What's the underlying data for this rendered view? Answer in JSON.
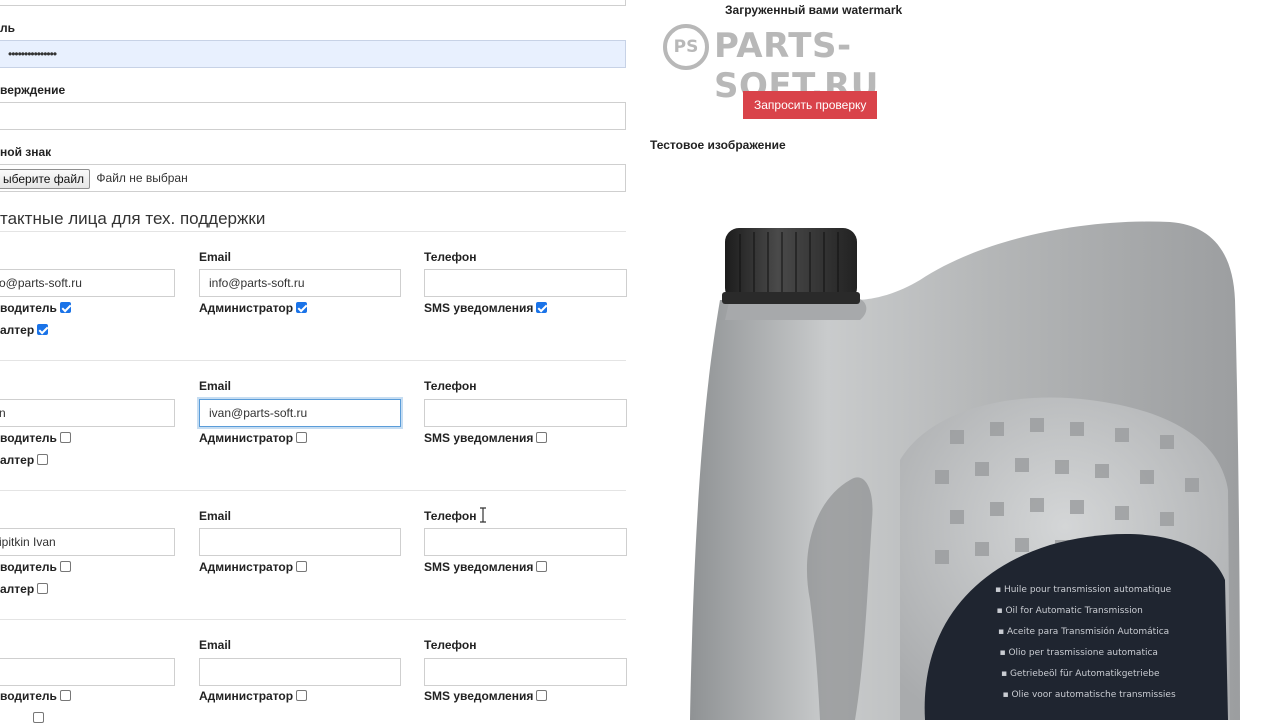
{
  "form": {
    "password_label": "ль",
    "password_value": "•••••••••••••••",
    "confirm_label": "верждение",
    "confirm_value": "",
    "watermark_label": "ной знак",
    "file_button": "ыберите файл",
    "file_status": "Файл не выбран",
    "contacts_title": "тактные лица для тех. поддержки"
  },
  "contacts": [
    {
      "name_value": "o@parts-soft.ru",
      "email_label": "Email",
      "email_value": "info@parts-soft.ru",
      "phone_label": "Телефон",
      "phone_value": "",
      "director_label": "водитель",
      "director_checked": true,
      "admin_label": "Администратор",
      "admin_checked": true,
      "sms_label": "SMS уведомления",
      "sms_checked": true,
      "accountant_label": "алтер",
      "accountant_checked": true
    },
    {
      "name_value": "n",
      "email_label": "Email",
      "email_value": "ivan@parts-soft.ru",
      "phone_label": "Телефон",
      "phone_value": "",
      "director_label": "водитель",
      "director_checked": false,
      "admin_label": "Администратор",
      "admin_checked": false,
      "sms_label": "SMS уведомления",
      "sms_checked": false,
      "accountant_label": "алтер",
      "accountant_checked": false
    },
    {
      "name_value": "ipitkin Ivan",
      "email_label": "Email",
      "email_value": "",
      "phone_label": "Телефон",
      "phone_value": "",
      "director_label": "водитель",
      "director_checked": false,
      "admin_label": "Администратор",
      "admin_checked": false,
      "sms_label": "SMS уведомления",
      "sms_checked": false,
      "accountant_label": "алтер",
      "accountant_checked": false
    },
    {
      "name_value": "",
      "email_label": "Email",
      "email_value": "",
      "phone_label": "Телефон",
      "phone_value": "",
      "director_label": "водитель",
      "director_checked": false,
      "admin_label": "Администратор",
      "admin_checked": false,
      "sms_label": "SMS уведомления",
      "sms_checked": false,
      "accountant_label": "алтер",
      "accountant_checked": false
    }
  ],
  "right": {
    "uploaded_watermark_label": "Загруженный вами watermark",
    "logo_mark": "PS",
    "logo_text": "PARTS-SOFT.RU",
    "request_button": "Запросить проверку",
    "test_image_label": "Тестовое изображение",
    "bottle_text_lines": [
      "Huile pour transmission automatique",
      "Oil for Automatic Transmission",
      "Aceite para Transmisión Automática",
      "Olio per trasmissione automatica",
      "Getriebeöl für Automatikgetriebe",
      "Olie voor automatische transmissies"
    ]
  },
  "colors": {
    "accent_red": "#d9434a",
    "checkbox_blue": "#1a73e8",
    "focus_blue": "#5b9dd9",
    "autofill_bg": "#e8f0fe"
  }
}
